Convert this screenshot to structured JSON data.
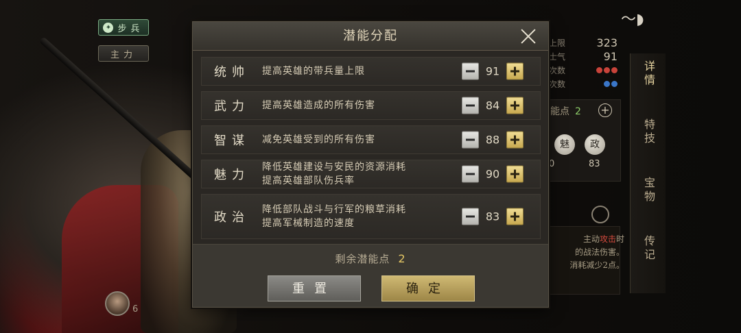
{
  "background": {
    "tags": {
      "infantry": "步兵",
      "main": "主力"
    },
    "avatar_count": "6",
    "stats": [
      {
        "label": "上限",
        "value": "323"
      },
      {
        "label": "士气",
        "value": "91"
      },
      {
        "label": "次数",
        "value": ""
      },
      {
        "label": "次数",
        "value": ""
      }
    ],
    "potential_label": "能点",
    "potential_value": "2",
    "badges": [
      {
        "label": "魅",
        "value": "0"
      },
      {
        "label": "政",
        "value": "83"
      }
    ],
    "desc_lines": [
      {
        "text": "主动",
        "highlight": "攻击",
        "tail": "时"
      },
      {
        "text": "的战法伤害。",
        "highlight": "",
        "tail": ""
      },
      {
        "text": "消耗减少2点。",
        "highlight": "",
        "tail": ""
      }
    ],
    "tabs": [
      "详情",
      "特技",
      "宝物",
      "传记"
    ]
  },
  "modal": {
    "title": "潜能分配",
    "stats": [
      {
        "name": "统帅",
        "lines": [
          "提高英雄的带兵量上限"
        ],
        "value": "91"
      },
      {
        "name": "武力",
        "lines": [
          "提高英雄造成的所有伤害"
        ],
        "value": "84"
      },
      {
        "name": "智谋",
        "lines": [
          "减免英雄受到的所有伤害"
        ],
        "value": "88"
      },
      {
        "name": "魅力",
        "lines": [
          "降低英雄建设与安民的资源消耗",
          "提高英雄部队伤兵率"
        ],
        "value": "90"
      },
      {
        "name": "政治",
        "lines": [
          "降低部队战斗与行军的粮草消耗",
          "提高军械制造的速度"
        ],
        "value": "83"
      }
    ],
    "remaining_label": "剩余潜能点",
    "remaining_value": "2",
    "reset_label": "重置",
    "confirm_label": "确定"
  },
  "colors": {
    "accent_gold": "#e6c865",
    "plus_button": "#c8a950",
    "minus_button": "#b6b5b0"
  }
}
